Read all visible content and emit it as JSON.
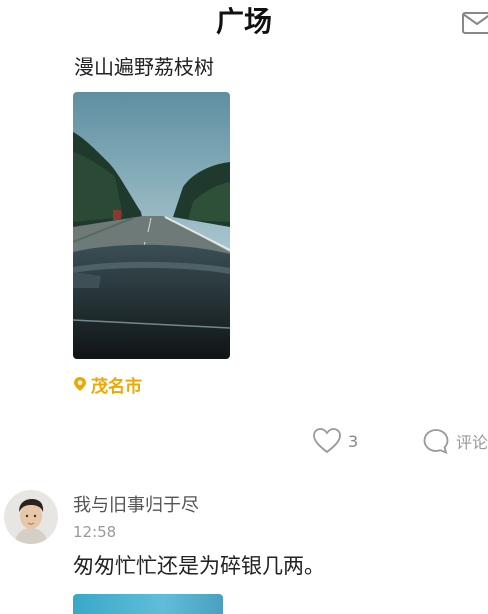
{
  "header": {
    "title": "广场",
    "mail_icon": "mail-icon"
  },
  "posts": [
    {
      "text": "漫山遍野荔枝树",
      "image_description_icon": "road-photo",
      "location": "茂名市",
      "location_icon": "location-pin-icon",
      "location_color": "#f0a800",
      "like_count": "3",
      "like_icon": "heart-outline-icon",
      "comment_label": "评论",
      "comment_icon": "comment-bubble-icon"
    },
    {
      "username": "我与旧事归于尽",
      "time": "12:58",
      "text": "匆匆忙忙还是为碎银几两。"
    }
  ]
}
